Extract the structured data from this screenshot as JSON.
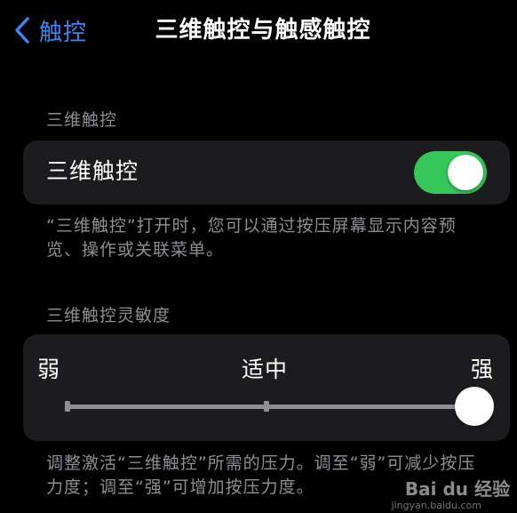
{
  "nav": {
    "back_label": "触控",
    "title": "三维触控与触感触控"
  },
  "section_3d_touch": {
    "header": "三维触控",
    "row_label": "三维触控",
    "toggle_on": true,
    "footnote": "“三维触控”打开时，您可以通过按压屏幕显示内容预览、操作或关联菜单。"
  },
  "section_sensitivity": {
    "header": "三维触控灵敏度",
    "label_light": "弱",
    "label_medium": "适中",
    "label_firm": "强",
    "options": [
      "弱",
      "适中",
      "强"
    ],
    "selected": "强",
    "footnote": "调整激活“三维触控”所需的压力。调至“弱”可减少按压力度；调至“强”可增加按压力度。"
  },
  "watermark": {
    "text": "Bai du 经验",
    "sub": "jingyan.baidu.com"
  },
  "colors": {
    "accent": "#3a86f8",
    "toggle_on": "#34c759",
    "background": "#000000",
    "card": "#1c1c1e",
    "secondary_text": "#8e8e93"
  },
  "icons": {
    "back": "chevron-left-icon"
  }
}
